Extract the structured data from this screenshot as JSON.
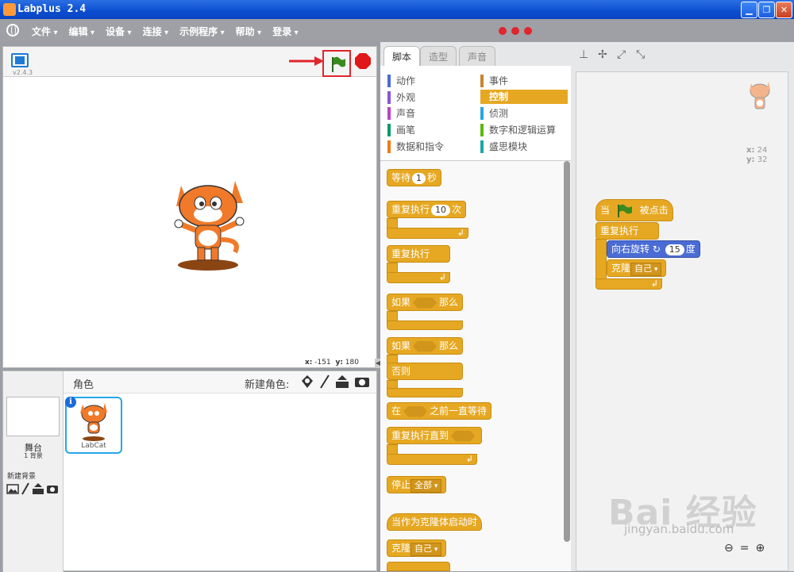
{
  "window": {
    "title": "Labplus 2.4",
    "minimize": "▁",
    "maximize": "❐",
    "close": "✕"
  },
  "menu": {
    "items": [
      "文件",
      "编辑",
      "设备",
      "连接",
      "示例程序",
      "帮助",
      "登录"
    ]
  },
  "stage": {
    "version": "v2.4.3",
    "x_label": "x:",
    "x_value": "-151",
    "y_label": "y:",
    "y_value": "180"
  },
  "sprites": {
    "title": "角色",
    "new_sprite_label": "新建角色:",
    "stage_name": "舞台",
    "stage_backdrops": "1 背景",
    "new_backdrop": "新建背景",
    "selected_sprite": "LabCat",
    "info": "i"
  },
  "tabs": [
    "脚本",
    "造型",
    "声音"
  ],
  "categories": [
    {
      "label": "动作",
      "color": "#4a6cd4"
    },
    {
      "label": "事件",
      "color": "#c88330"
    },
    {
      "label": "外观",
      "color": "#8a55d7"
    },
    {
      "label": "控制",
      "color": "#e6a822"
    },
    {
      "label": "声音",
      "color": "#bb42c3"
    },
    {
      "label": "侦测",
      "color": "#2ca5e2"
    },
    {
      "label": "画笔",
      "color": "#0e9a6c"
    },
    {
      "label": "数字和逻辑运算",
      "color": "#5cb712"
    },
    {
      "label": "数据和指令",
      "color": "#ee7d16"
    },
    {
      "label": "盛思模块",
      "color": "#20a5a5"
    }
  ],
  "palette_blocks": {
    "wait": "等待",
    "wait_value": "1",
    "wait_unit": "秒",
    "repeat": "重复执行",
    "repeat_value": "10",
    "repeat_unit": "次",
    "forever": "重复执行",
    "if": "如果",
    "then": "那么",
    "if2": "如果",
    "then2": "那么",
    "else": "否则",
    "wait_until_pre": "在",
    "wait_until_post": "之前一直等待",
    "repeat_until": "重复执行直到",
    "stop": "停止",
    "stop_option": "全部",
    "clone_start": "当作为克隆体启动时",
    "clone": "克隆",
    "clone_option": "自己"
  },
  "script": {
    "when_flag_pre": "当",
    "when_flag_post": "被点击",
    "forever": "重复执行",
    "turn_right": "向右旋转",
    "turn_value": "15",
    "turn_unit": "度",
    "clone": "克隆",
    "clone_option": "自己"
  },
  "canvas": {
    "x_label": "x:",
    "x_value": "24",
    "y_label": "y:",
    "y_value": "32"
  },
  "zoom": {
    "out": "🔍−",
    "reset": "=",
    "in": "🔍+"
  },
  "watermark": {
    "brand": "Bai 经验",
    "url": "jingyan.baidu.com"
  }
}
